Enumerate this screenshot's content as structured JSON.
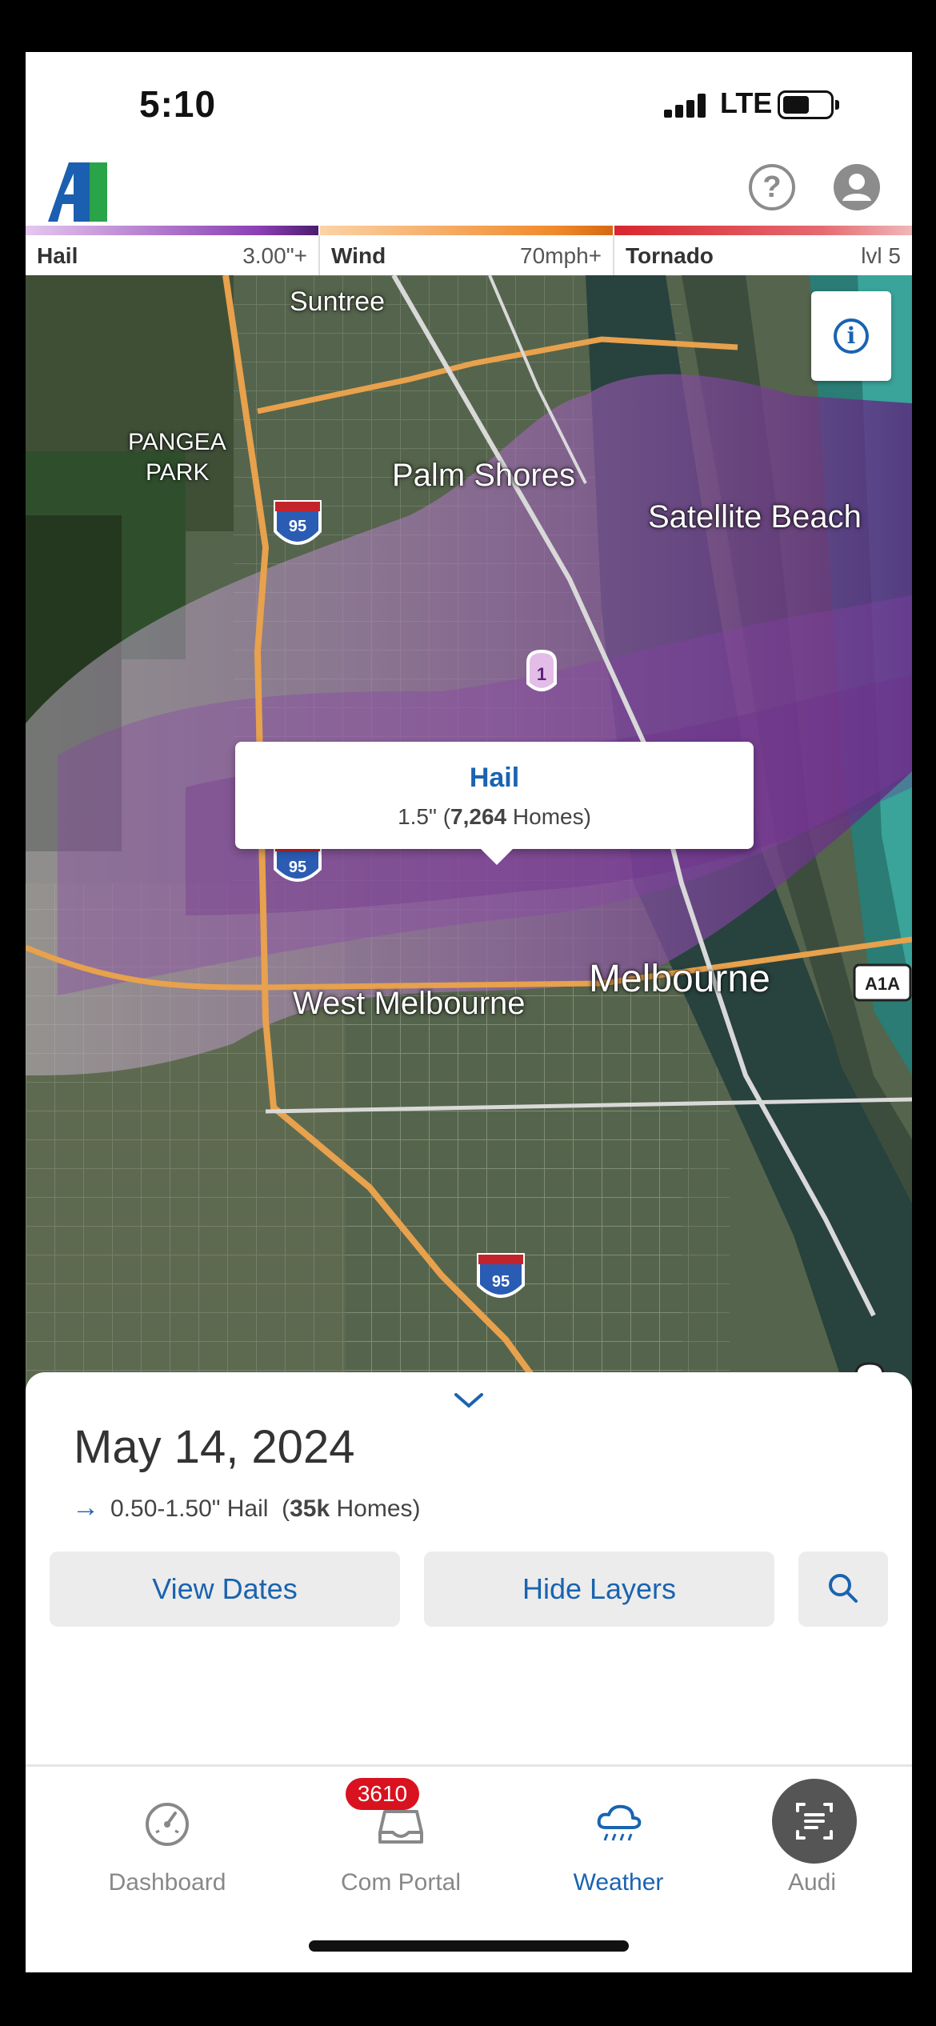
{
  "status_bar": {
    "time": "5:10",
    "network": "LTE"
  },
  "header": {
    "logo_text": "AI",
    "icons": [
      "help-icon",
      "profile-icon"
    ]
  },
  "legend": [
    {
      "name": "Hail",
      "value": "3.00\"+",
      "color": "#8a3fb3"
    },
    {
      "name": "Wind",
      "value": "70mph+",
      "color": "#f08a2c"
    },
    {
      "name": "Tornado",
      "value": "lvl 5",
      "color": "#d8262f"
    }
  ],
  "map": {
    "labels": {
      "suntree": "Suntree",
      "pangea1": "PANGEA",
      "pangea2": "PARK",
      "palm_shores": "Palm Shores",
      "satellite_beach": "Satellite Beach",
      "west_melbourne": "West Melbourne",
      "melbourne": "Melbourne"
    },
    "shields": {
      "i95": "95",
      "us1": "1",
      "a1a": "A1A"
    },
    "popup": {
      "title": "Hail",
      "size": "1.5\"",
      "homes_count": "7,264",
      "homes_label": "Homes"
    }
  },
  "sheet": {
    "date": "May 14, 2024",
    "range": "0.50-1.50\" Hail",
    "homes_count": "35k",
    "homes_label": "Homes",
    "buttons": {
      "view_dates": "View Dates",
      "hide_layers": "Hide Layers"
    }
  },
  "tabs": [
    {
      "label": "Dashboard",
      "icon": "dashboard-icon",
      "active": false
    },
    {
      "label": "Com Portal",
      "icon": "inbox-icon",
      "active": false,
      "badge": "3610"
    },
    {
      "label": "Weather",
      "icon": "weather-icon",
      "active": true
    },
    {
      "label": "Audi",
      "icon": "audience-icon",
      "active": false
    }
  ],
  "colors": {
    "accent": "#1a63b0",
    "badge": "#d8121f",
    "hail_overlay": "#b070c8"
  }
}
